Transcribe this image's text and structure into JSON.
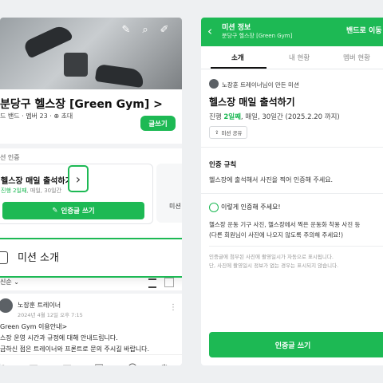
{
  "left": {
    "band_title": "분당구 헬스장 [Green Gym] >",
    "band_meta": "드 밴드 · 멤버 23 · ⊕ 초대",
    "write_button": "글쓰기",
    "section_label": "선 인증",
    "mission_card": {
      "title": "헬스장 매일 출석하기",
      "progress": "진행 2일째, 매일, 30일간",
      "button": "인증글 쓰기"
    },
    "mission_card2_label": "미션",
    "callout": "미션 소개",
    "sort_label": "신순 ⌄",
    "post": {
      "author": "노장훈 트레이너",
      "date": "2024년 4월 12일 오후 7:15",
      "lines": [
        "Green Gym 이용안내>",
        "스장 운영 시간과 규정에 대해 안내드립니다.",
        "금하신 점은 트레이너와 프론트로 문의 주시길 바랍니다."
      ]
    }
  },
  "right": {
    "header_title": "미션 정보",
    "header_subtitle": "분당구 헬스장 [Green Gym]",
    "band_button": "밴드로 이동",
    "tabs": [
      "소개",
      "내 현황",
      "멤버 현황"
    ],
    "active_tab": "소개",
    "creator": "노장훈 트레이너님이 만든 미션",
    "mission_title": "헬스장 매일 출석하기",
    "progress_prefix": "진행 ",
    "progress_day": "2일째",
    "progress_rest": ", 매일, 30일간 (2025.2.20 까지)",
    "share_label": "미션 공유",
    "rule_heading": "인증 규칙",
    "rule_text": "헬스장에 출석해서 사진을 찍어 인증해 주세요.",
    "how_heading": "이렇게 인증해 주세요!",
    "how_lines": [
      "헬스장 운동 기구 사진, 헬스장에서 찍은 운동화 착용 사진 등",
      "(다른 회원님이 사진에 나오지 않도록 주의해 주세요!)"
    ],
    "notes": [
      "인증글에 첨부된 사진에 촬영일시가 자동으로 표시됩니다.",
      "단, 사진에 촬영일시 정보가 없는 경우는 표시되지 않습니다."
    ],
    "cta": "인증글 쓰기"
  },
  "colors": {
    "accent": "#1db954",
    "background": "#eef0f2"
  }
}
